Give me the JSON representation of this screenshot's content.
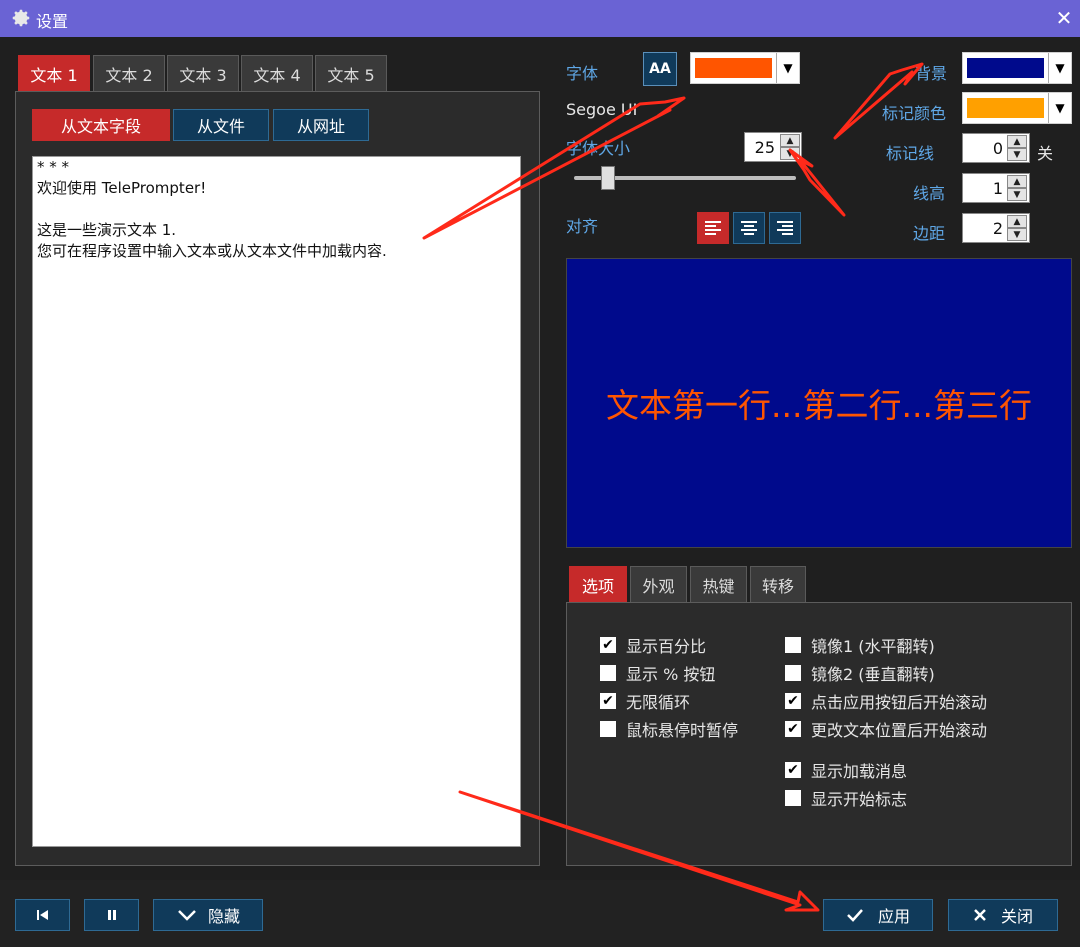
{
  "window": {
    "title": "设置",
    "close_label": "✕"
  },
  "text_tabs": [
    "文本 1",
    "文本 2",
    "文本 3",
    "文本 4",
    "文本 5"
  ],
  "source_buttons": [
    "从文本字段",
    "从文件",
    "从网址"
  ],
  "editor_text": "* * *\n欢迎使用 TelePrompter!\n\n这是一些演示文本 1.\n您可在程序设置中输入文本或从文本文件中加载内容.",
  "font": {
    "label": "字体",
    "aa_icon_text": "AA",
    "font_color": "#ff5500",
    "font_name": "Segoe UI",
    "size_label": "字体大小",
    "size_value": "25",
    "slider_percent": 13,
    "align_label": "对齐"
  },
  "right_props": {
    "background_label": "背景",
    "background_color": "#000a8c",
    "marker_color_label": "标记颜色",
    "marker_color": "#ffa000",
    "marker_line_label": "标记线",
    "marker_line_value": "0",
    "marker_line_off": "关",
    "line_height_label": "线高",
    "line_height_value": "1",
    "margin_label": "边距",
    "margin_value": "2"
  },
  "preview_text": "文本第一行...第二行...第三行",
  "option_tabs": [
    "选项",
    "外观",
    "热键",
    "转移"
  ],
  "options_left": [
    {
      "label": "显示百分比",
      "checked": true
    },
    {
      "label": "显示 % 按钮",
      "checked": false
    },
    {
      "label": "无限循环",
      "checked": true
    },
    {
      "label": "鼠标悬停时暂停",
      "checked": false
    }
  ],
  "options_right": [
    {
      "label": "镜像1 (水平翻转)",
      "checked": false
    },
    {
      "label": "镜像2 (垂直翻转)",
      "checked": false
    },
    {
      "label": "点击应用按钮后开始滚动",
      "checked": true
    },
    {
      "label": "更改文本位置后开始滚动",
      "checked": true
    },
    {
      "label": "显示加载消息",
      "checked": true
    },
    {
      "label": "显示开始标志",
      "checked": false
    }
  ],
  "footer": {
    "hide_label": "隐藏",
    "apply_label": "应用",
    "close_label": "关闭"
  },
  "colors": {
    "accent_red": "#c62a2a",
    "titlebar": "#6a63d4",
    "button_blue": "#103a5a"
  }
}
